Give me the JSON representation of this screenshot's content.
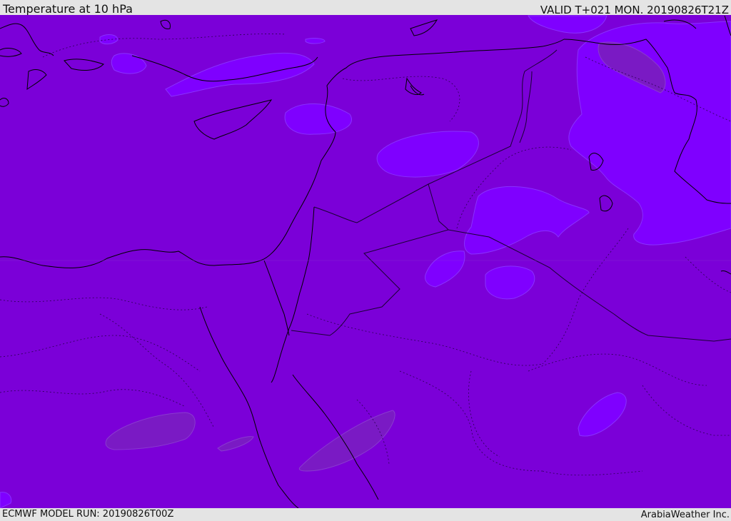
{
  "header": {
    "title": "Temperature at 10 hPa",
    "valid": "VALID T+021 MON. 20190826T21Z"
  },
  "footer": {
    "model_run": "ECMWF MODEL RUN: 20190826T00Z",
    "credit": "ArabiaWeather Inc."
  },
  "map": {
    "field": "Temperature at 10 hPa",
    "colors": {
      "background_field": "#7b00d8",
      "cold_patch": "#7f00ff",
      "warm_patch": "#7a1ac4",
      "coastline": "#000000",
      "border": "#1a0033"
    }
  }
}
